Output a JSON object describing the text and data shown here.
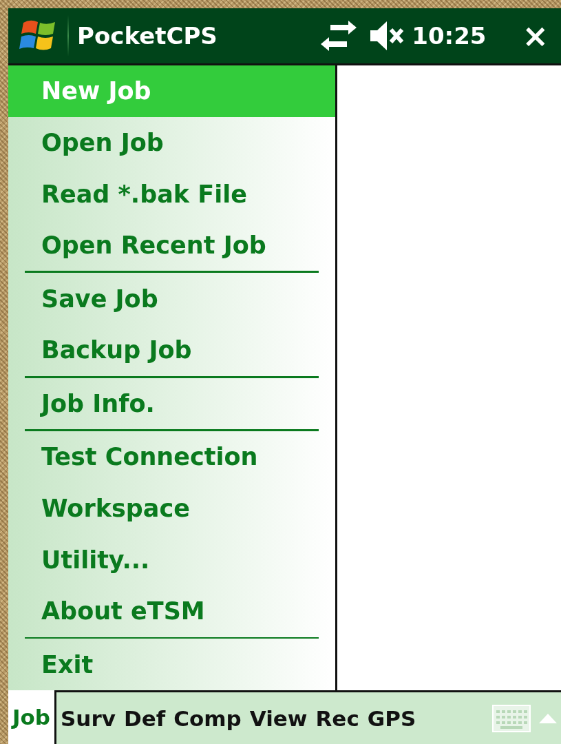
{
  "title_bar": {
    "title": "PocketCPS",
    "time": "10:25",
    "close": "×"
  },
  "menu": {
    "groups": [
      [
        {
          "label": "New Job",
          "selected": true
        },
        {
          "label": "Open Job",
          "selected": false
        },
        {
          "label": "Read *.bak File",
          "selected": false
        },
        {
          "label": "Open Recent Job",
          "selected": false
        }
      ],
      [
        {
          "label": "Save Job",
          "selected": false
        },
        {
          "label": "Backup Job",
          "selected": false
        }
      ],
      [
        {
          "label": "Job Info.",
          "selected": false
        }
      ],
      [
        {
          "label": "Test Connection",
          "selected": false
        },
        {
          "label": "Workspace",
          "selected": false
        },
        {
          "label": "Utility...",
          "selected": false
        },
        {
          "label": "About eTSM",
          "selected": false
        }
      ],
      [
        {
          "label": "Exit",
          "selected": false
        }
      ]
    ]
  },
  "menu_bar": {
    "items": [
      {
        "label": "Job",
        "selected": true
      },
      {
        "label": "Surv",
        "selected": false
      },
      {
        "label": "Def",
        "selected": false
      },
      {
        "label": "Comp",
        "selected": false
      },
      {
        "label": "View",
        "selected": false
      },
      {
        "label": "Rec",
        "selected": false
      },
      {
        "label": "GPS",
        "selected": false
      }
    ]
  }
}
